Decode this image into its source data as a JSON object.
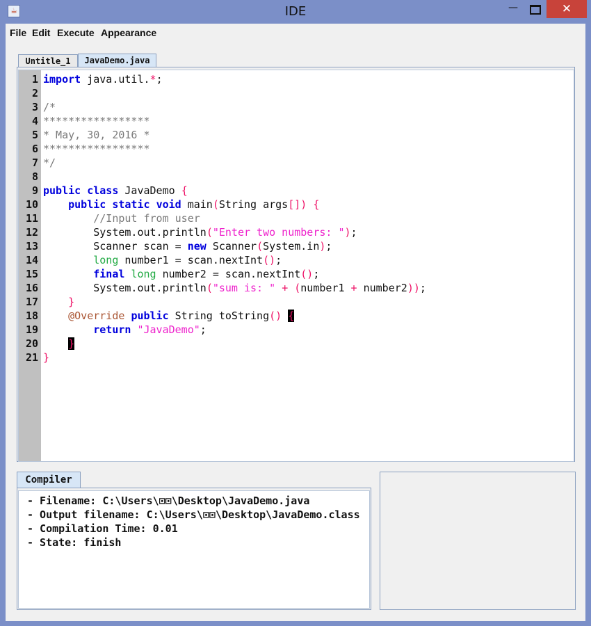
{
  "window": {
    "title": "IDE",
    "controls": {
      "minimize": "—",
      "close": "✕"
    }
  },
  "menu": [
    "File",
    "Edit",
    "Execute",
    "Appearance"
  ],
  "tabs": [
    "Untitle_1",
    "JavaDemo.java"
  ],
  "active_tab": "JavaDemo.java",
  "editor": {
    "line_numbers": [
      "1",
      "2",
      "3",
      "4",
      "5",
      "6",
      "7",
      "8",
      "9",
      "10",
      "11",
      "12",
      "13",
      "14",
      "15",
      "16",
      "17",
      "18",
      "19",
      "20",
      "21"
    ],
    "code_lines": [
      "import java.util.*;",
      "",
      "/*",
      "*****************",
      "* May, 30, 2016 *",
      "*****************",
      "*/",
      "",
      "public class JavaDemo {",
      "    public static void main(String args[]) {",
      "        //Input from user",
      "        System.out.println(\"Enter two numbers: \");",
      "        Scanner scan = new Scanner(System.in);",
      "        long number1 = scan.nextInt();",
      "        final long number2 = scan.nextInt();",
      "        System.out.println(\"sum is: \" + (number1 + number2));",
      "    }",
      "    @Override public String toString() {",
      "        return \"JavaDemo\";",
      "    }",
      "}"
    ]
  },
  "compiler": {
    "tab_label": "Compiler",
    "output": [
      "- Filename: C:\\Users\\⊡⊡\\Desktop\\JavaDemo.java",
      "- Output filename: C:\\Users\\⊡⊡\\Desktop\\JavaDemo.class",
      "- Compilation Time: 0.01",
      "- State: finish"
    ]
  },
  "colors": {
    "titlebar": "#7b8fc8",
    "close_button": "#c8433a",
    "keyword": "#0000dd",
    "type_keyword": "#22aa44",
    "punctuation": "#ee1166",
    "string": "#ee22cc",
    "comment": "#7a7a7a",
    "annotation": "#aa5533",
    "gutter": "#c0c0c0"
  }
}
